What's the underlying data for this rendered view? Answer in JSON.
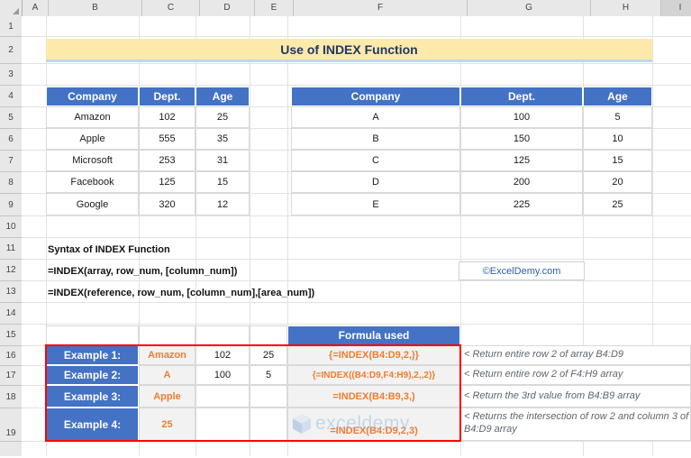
{
  "app": {
    "columns": [
      "A",
      "B",
      "C",
      "D",
      "E",
      "F",
      "G",
      "H",
      "I"
    ],
    "selected_column": "I",
    "rows": [
      "1",
      "2",
      "3",
      "4",
      "5",
      "6",
      "7",
      "8",
      "9",
      "10",
      "11",
      "12",
      "13",
      "14",
      "15",
      "16",
      "17",
      "18",
      "19"
    ]
  },
  "banner": {
    "title": "Use of INDEX Function"
  },
  "left_table": {
    "headers": [
      "Company",
      "Dept.",
      "Age"
    ],
    "rows": [
      [
        "Amazon",
        "102",
        "25"
      ],
      [
        "Apple",
        "555",
        "35"
      ],
      [
        "Microsoft",
        "253",
        "31"
      ],
      [
        "Facebook",
        "125",
        "15"
      ],
      [
        "Google",
        "320",
        "12"
      ]
    ]
  },
  "right_table": {
    "headers": [
      "Company",
      "Dept.",
      "Age"
    ],
    "rows": [
      [
        "A",
        "100",
        "5"
      ],
      [
        "B",
        "150",
        "10"
      ],
      [
        "C",
        "125",
        "15"
      ],
      [
        "D",
        "200",
        "20"
      ],
      [
        "E",
        "225",
        "25"
      ]
    ]
  },
  "syntax": {
    "heading": "Syntax of INDEX Function",
    "line1": "=INDEX(array, row_num, [column_num])",
    "line2": "=INDEX(reference, row_num, [column_num],[area_num])"
  },
  "watermark_box": {
    "text": "©ExcelDemy.com"
  },
  "watermark_overlay": {
    "text": "exceldemy"
  },
  "examples": {
    "formula_header": "Formula used",
    "rows": [
      {
        "label": "Example 1:",
        "result": "Amazon",
        "col_c": "102",
        "col_d": "25",
        "formula": "{=INDEX(B4:D9,2,)}",
        "note": "< Return entire row 2 of array B4:D9"
      },
      {
        "label": "Example 2:",
        "result": "A",
        "col_c": "100",
        "col_d": "5",
        "formula": "{=INDEX((B4:D9,F4:H9),2,,2)}",
        "note": "< Return entire row 2 of F4:H9 array"
      },
      {
        "label": "Example 3:",
        "result": "Apple",
        "col_c": "",
        "col_d": "",
        "formula": "=INDEX(B4:B9,3,)",
        "note": "< Return the 3rd value from B4:B9 array"
      },
      {
        "label": "Example 4:",
        "result": "25",
        "col_c": "",
        "col_d": "",
        "formula": "=INDEX(B4:D9,2,3)",
        "note": "< Returns the intersection of row 2 and column 3 of B4:D9 array"
      }
    ]
  },
  "colors": {
    "header_blue": "#4472C4",
    "banner_yellow": "#FDE9A9",
    "accent_orange": "#ED7D31",
    "highlight_red": "#FF0000"
  }
}
